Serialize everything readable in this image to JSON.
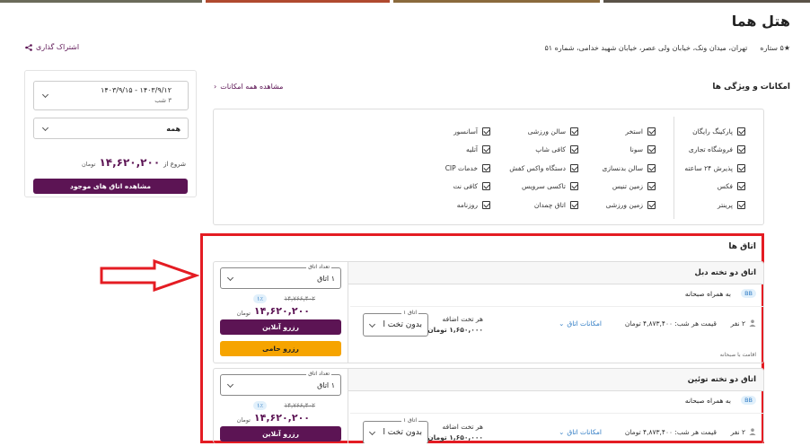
{
  "header": {
    "title": "هتل هما",
    "stars": "★۵ ستاره",
    "address": "تهران، میدان ونک، خیابان ولی عصر، خیابان شهید خدامی، شماره ۵۱",
    "share_label": "اشتراک گذاری"
  },
  "amenities": {
    "title": "امکانات و ویژگی ها",
    "see_all": "مشاهده همه امکانات",
    "columns": [
      [
        "پارکینگ رایگان",
        "فروشگاه تجاری",
        "پذیرش ۲۴ ساعته",
        "فکس",
        "پرینتر"
      ],
      [
        "استخر",
        "سونا",
        "سالن بدنسازی",
        "زمین تنیس",
        "زمین ورزشی"
      ],
      [
        "سالن ورزشی",
        "کافی شاپ",
        "دستگاه واکس کفش",
        "تاکسی سرویس",
        "اتاق چمدان"
      ],
      [
        "آسانسور",
        "آتلیه",
        "خدمات CIP",
        "کافی نت",
        "روزنامه"
      ]
    ]
  },
  "booking": {
    "dates": "۱۴۰۳/۹/۱۲ - ۱۴۰۳/۹/۱۵",
    "nights": "۳ شب",
    "guests": "همه",
    "from_label": "شروع از",
    "from_price": "۱۴,۶۲۰,۲۰۰",
    "currency": "تومان",
    "view_rooms": "مشاهده اتاق های موجود"
  },
  "rooms": {
    "title": "اتاق ها",
    "items": [
      {
        "name": "اتاق دو تخته دبل",
        "count_legend": "تعداد اتاق",
        "count_value": "۱ اتاق",
        "discount": "۱٪",
        "orig_price": "۱۴,۷۶۶,۴۰۲",
        "price": "۱۴,۶۲۰,۲۰۰",
        "currency": "تومان",
        "online_btn": "رزرو آنلاین",
        "sponsor_btn": "رزرو حامی",
        "breakfast_badge": "BB",
        "breakfast_label": "به همراه صبحانه",
        "persons": "۲ نفر",
        "nightly": "قیمت هر شب: ۴,۸۷۳,۴۰۰ تومان",
        "room_features": "امکانات اتاق",
        "extra_bed_label": "هر تخت اضافه",
        "extra_bed_price": "۱,۶۵۰,۰۰۰ تومان",
        "room_sel_legend": "اتاق ۱",
        "room_sel_value": "بدون تخت ا",
        "stay_note": "اقامت با صبحانه"
      },
      {
        "name": "اتاق دو تخته توئین",
        "count_legend": "تعداد اتاق",
        "count_value": "۱ اتاق",
        "discount": "۱٪",
        "orig_price": "۱۴,۷۶۶,۴۰۲",
        "price": "۱۴,۶۲۰,۲۰۰",
        "currency": "تومان",
        "online_btn": "رزرو آنلاین",
        "breakfast_badge": "BB",
        "breakfast_label": "به همراه صبحانه",
        "persons": "۲ نفر",
        "nightly": "قیمت هر شب: ۴,۸۷۳,۴۰۰ تومان",
        "room_features": "امکانات اتاق",
        "extra_bed_label": "هر تخت اضافه",
        "extra_bed_price": "۱,۶۵۰,۰۰۰ تومان",
        "room_sel_legend": "اتاق ۱",
        "room_sel_value": "بدون تخت ا"
      }
    ]
  },
  "colors": {
    "brand": "#5c1454",
    "highlight": "#e41c23",
    "orange": "#f6a400",
    "link_blue": "#2e7bc4"
  }
}
